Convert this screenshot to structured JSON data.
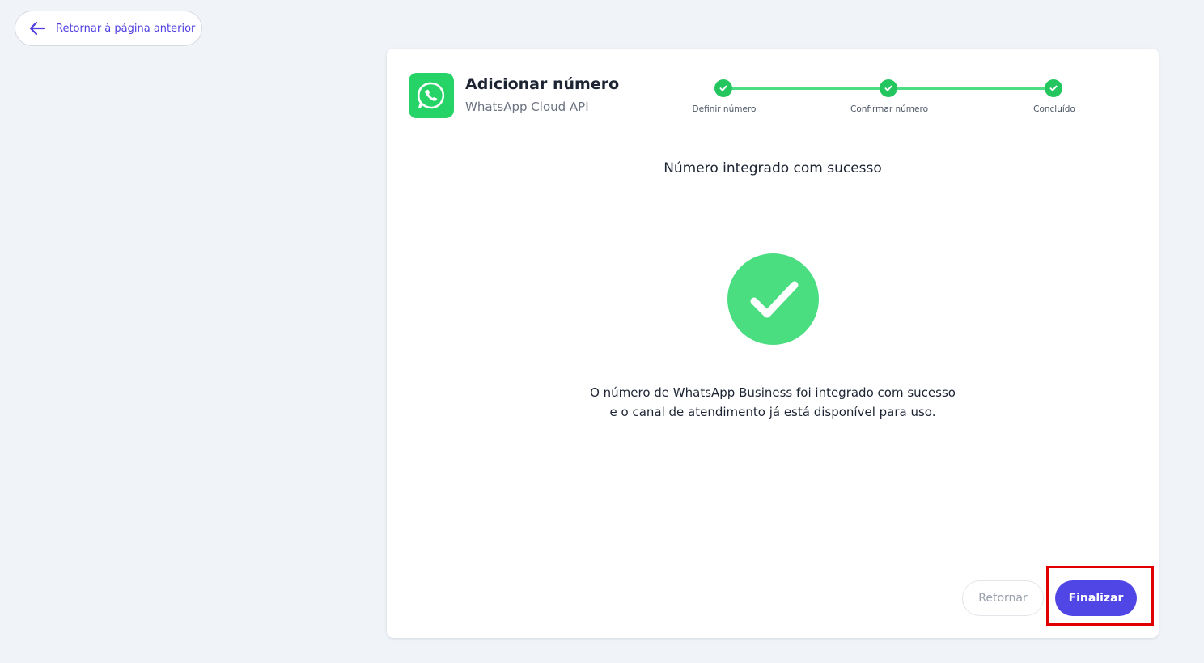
{
  "back_link": {
    "label": "Retornar à página anterior",
    "icon": "arrow-left-icon"
  },
  "card": {
    "logo_icon": "whatsapp-icon",
    "title": "Adicionar número",
    "subtitle": "WhatsApp Cloud API"
  },
  "stepper": {
    "steps": [
      {
        "label": "Definir número",
        "status": "completed"
      },
      {
        "label": "Confirmar número",
        "status": "completed"
      },
      {
        "label": "Concluído",
        "status": "completed"
      }
    ]
  },
  "result": {
    "heading": "Número integrado com sucesso",
    "icon": "check-circle-icon",
    "message_line1": "O número de WhatsApp Business foi integrado com sucesso",
    "message_line2": "e o canal de atendimento já está disponível para uso."
  },
  "actions": {
    "back_label": "Retornar",
    "finish_label": "Finalizar"
  },
  "colors": {
    "accent": "#4f46e5",
    "success": "#22c55e",
    "success_light": "#4ade80",
    "highlight": "#e00000"
  }
}
